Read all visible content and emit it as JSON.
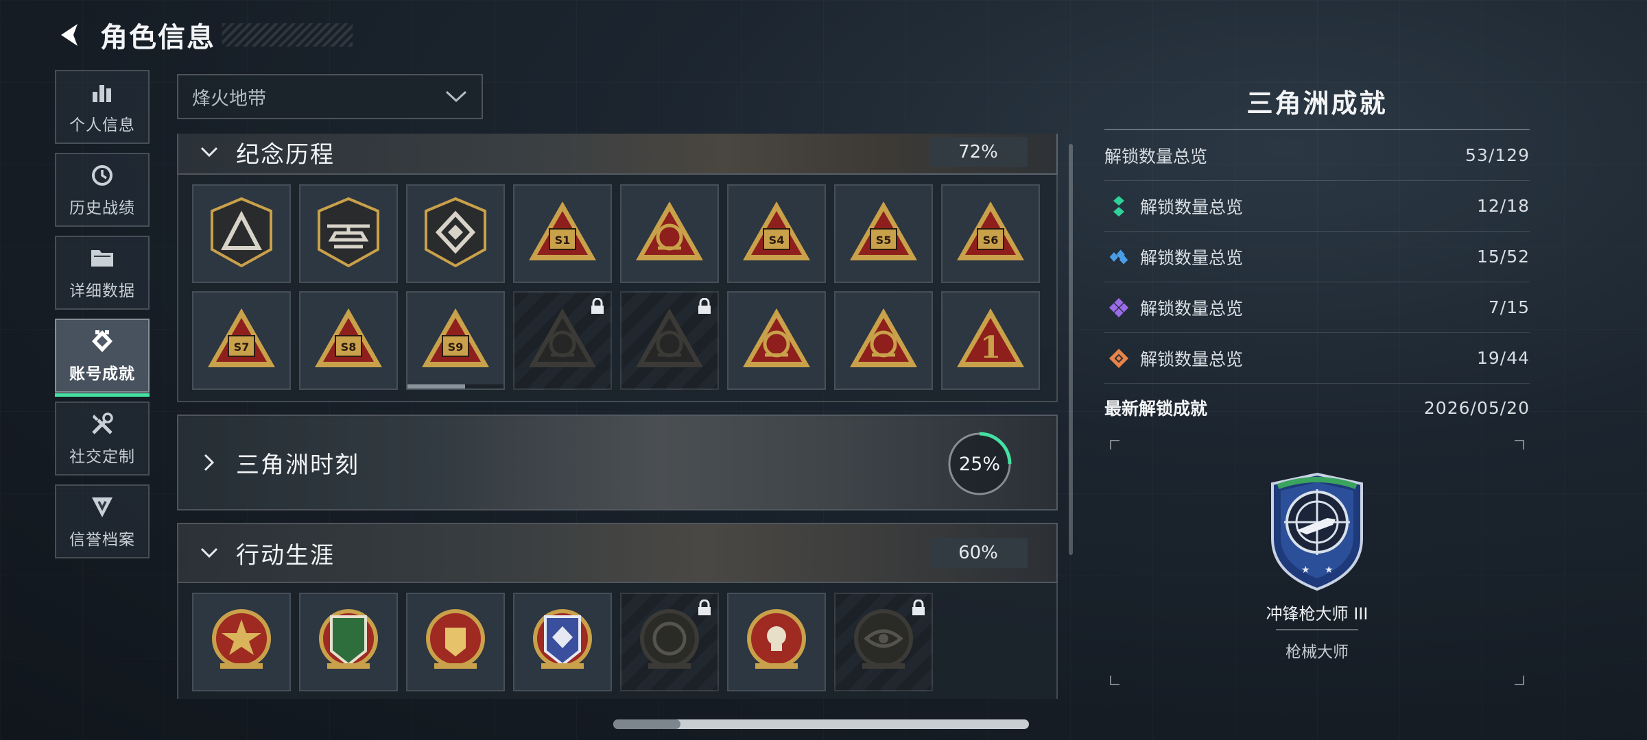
{
  "header": {
    "title": "角色信息"
  },
  "nav": {
    "items": [
      {
        "label": "个人信息",
        "icon": "bar-chart-icon",
        "active": false
      },
      {
        "label": "历史战绩",
        "icon": "history-icon",
        "active": false
      },
      {
        "label": "详细数据",
        "icon": "folder-icon",
        "active": false
      },
      {
        "label": "账号成就",
        "icon": "achievement-icon",
        "active": true
      },
      {
        "label": "社交定制",
        "icon": "tools-icon",
        "active": false
      },
      {
        "label": "信誉档案",
        "icon": "reputation-icon",
        "active": false
      }
    ]
  },
  "mode_select": {
    "value": "烽火地带"
  },
  "sections": [
    {
      "title": "纪念历程",
      "expanded": true,
      "progress_percent": 72,
      "badges": [
        {
          "icon": "delta-emblem-icon",
          "locked": false
        },
        {
          "icon": "helicopter-emblem-icon",
          "locked": false
        },
        {
          "icon": "diamond-emblem-icon",
          "locked": false
        },
        {
          "icon": "s1-balloon-badge-icon",
          "locked": false,
          "text": "S1"
        },
        {
          "icon": "globe-triangle-badge-icon",
          "locked": false
        },
        {
          "icon": "s4-triangle-badge-icon",
          "locked": false,
          "text": "S4"
        },
        {
          "icon": "s5-triangle-badge-icon",
          "locked": false,
          "text": "S5"
        },
        {
          "icon": "s6-triangle-badge-icon",
          "locked": false,
          "text": "S6"
        },
        {
          "icon": "s7-triangle-badge-icon",
          "locked": false,
          "text": "S7"
        },
        {
          "icon": "s8-triangle-badge-icon",
          "locked": false,
          "text": "S8"
        },
        {
          "icon": "s9-triangle-badge-icon",
          "locked": false,
          "text": "S9",
          "progress": 0.6
        },
        {
          "icon": "hooded-figure-badge-icon",
          "locked": true
        },
        {
          "icon": "crossed-swords-badge-icon",
          "locked": true
        },
        {
          "icon": "vehicle-triangle-badge-icon",
          "locked": false
        },
        {
          "icon": "boat-triangle-badge-icon",
          "locked": false
        },
        {
          "icon": "number-one-triangle-badge-icon",
          "locked": false,
          "text": "1"
        }
      ]
    },
    {
      "title": "三角洲时刻",
      "expanded": false,
      "progress_percent": 25
    },
    {
      "title": "行动生涯",
      "expanded": true,
      "progress_percent": 60,
      "badges": [
        {
          "icon": "star-shield-medal-icon",
          "locked": false
        },
        {
          "icon": "green-shield-medal-icon",
          "locked": false
        },
        {
          "icon": "red-winged-medal-icon",
          "locked": false
        },
        {
          "icon": "diamond-shield-medal-icon",
          "locked": false
        },
        {
          "icon": "shell-medal-icon",
          "locked": true
        },
        {
          "icon": "skull-medal-icon",
          "locked": false
        },
        {
          "icon": "eye-medal-icon",
          "locked": true
        }
      ]
    }
  ],
  "panel": {
    "title": "三角洲成就",
    "summary": {
      "label": "解锁数量总览",
      "value": "53/129"
    },
    "tiers": [
      {
        "label": "解锁数量总览",
        "value": "12/18",
        "color": "#2fd39a",
        "icon": "green-tier-icon"
      },
      {
        "label": "解锁数量总览",
        "value": "15/52",
        "color": "#4a9de8",
        "icon": "blue-tier-icon"
      },
      {
        "label": "解锁数量总览",
        "value": "7/15",
        "color": "#9b6be8",
        "icon": "purple-tier-icon"
      },
      {
        "label": "解锁数量总览",
        "value": "19/44",
        "color": "#e8844a",
        "icon": "orange-tier-icon"
      }
    ],
    "latest": {
      "label": "最新解锁成就",
      "date": "2026/05/20"
    },
    "featured": {
      "name": "冲锋枪大师 III",
      "category": "枪械大师",
      "icon": "smg-master-badge-icon"
    }
  },
  "colors": {
    "accent": "#45e0a2",
    "gold": "#c9a14a",
    "crimson": "#8e1f1c"
  }
}
